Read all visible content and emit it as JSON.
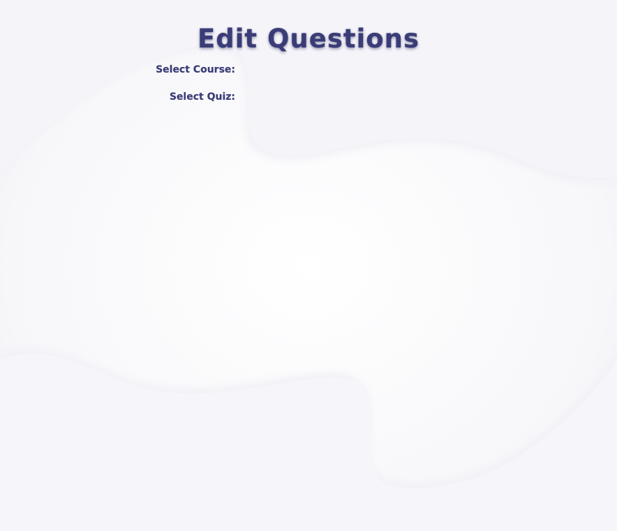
{
  "page": {
    "title": "Edit Questions"
  },
  "form": {
    "course_label": "Select Course:",
    "quiz_label": "Select Quiz:"
  },
  "colors": {
    "title": "#3a3c77",
    "background": "#ecebf2",
    "panel": "#ffffff"
  }
}
